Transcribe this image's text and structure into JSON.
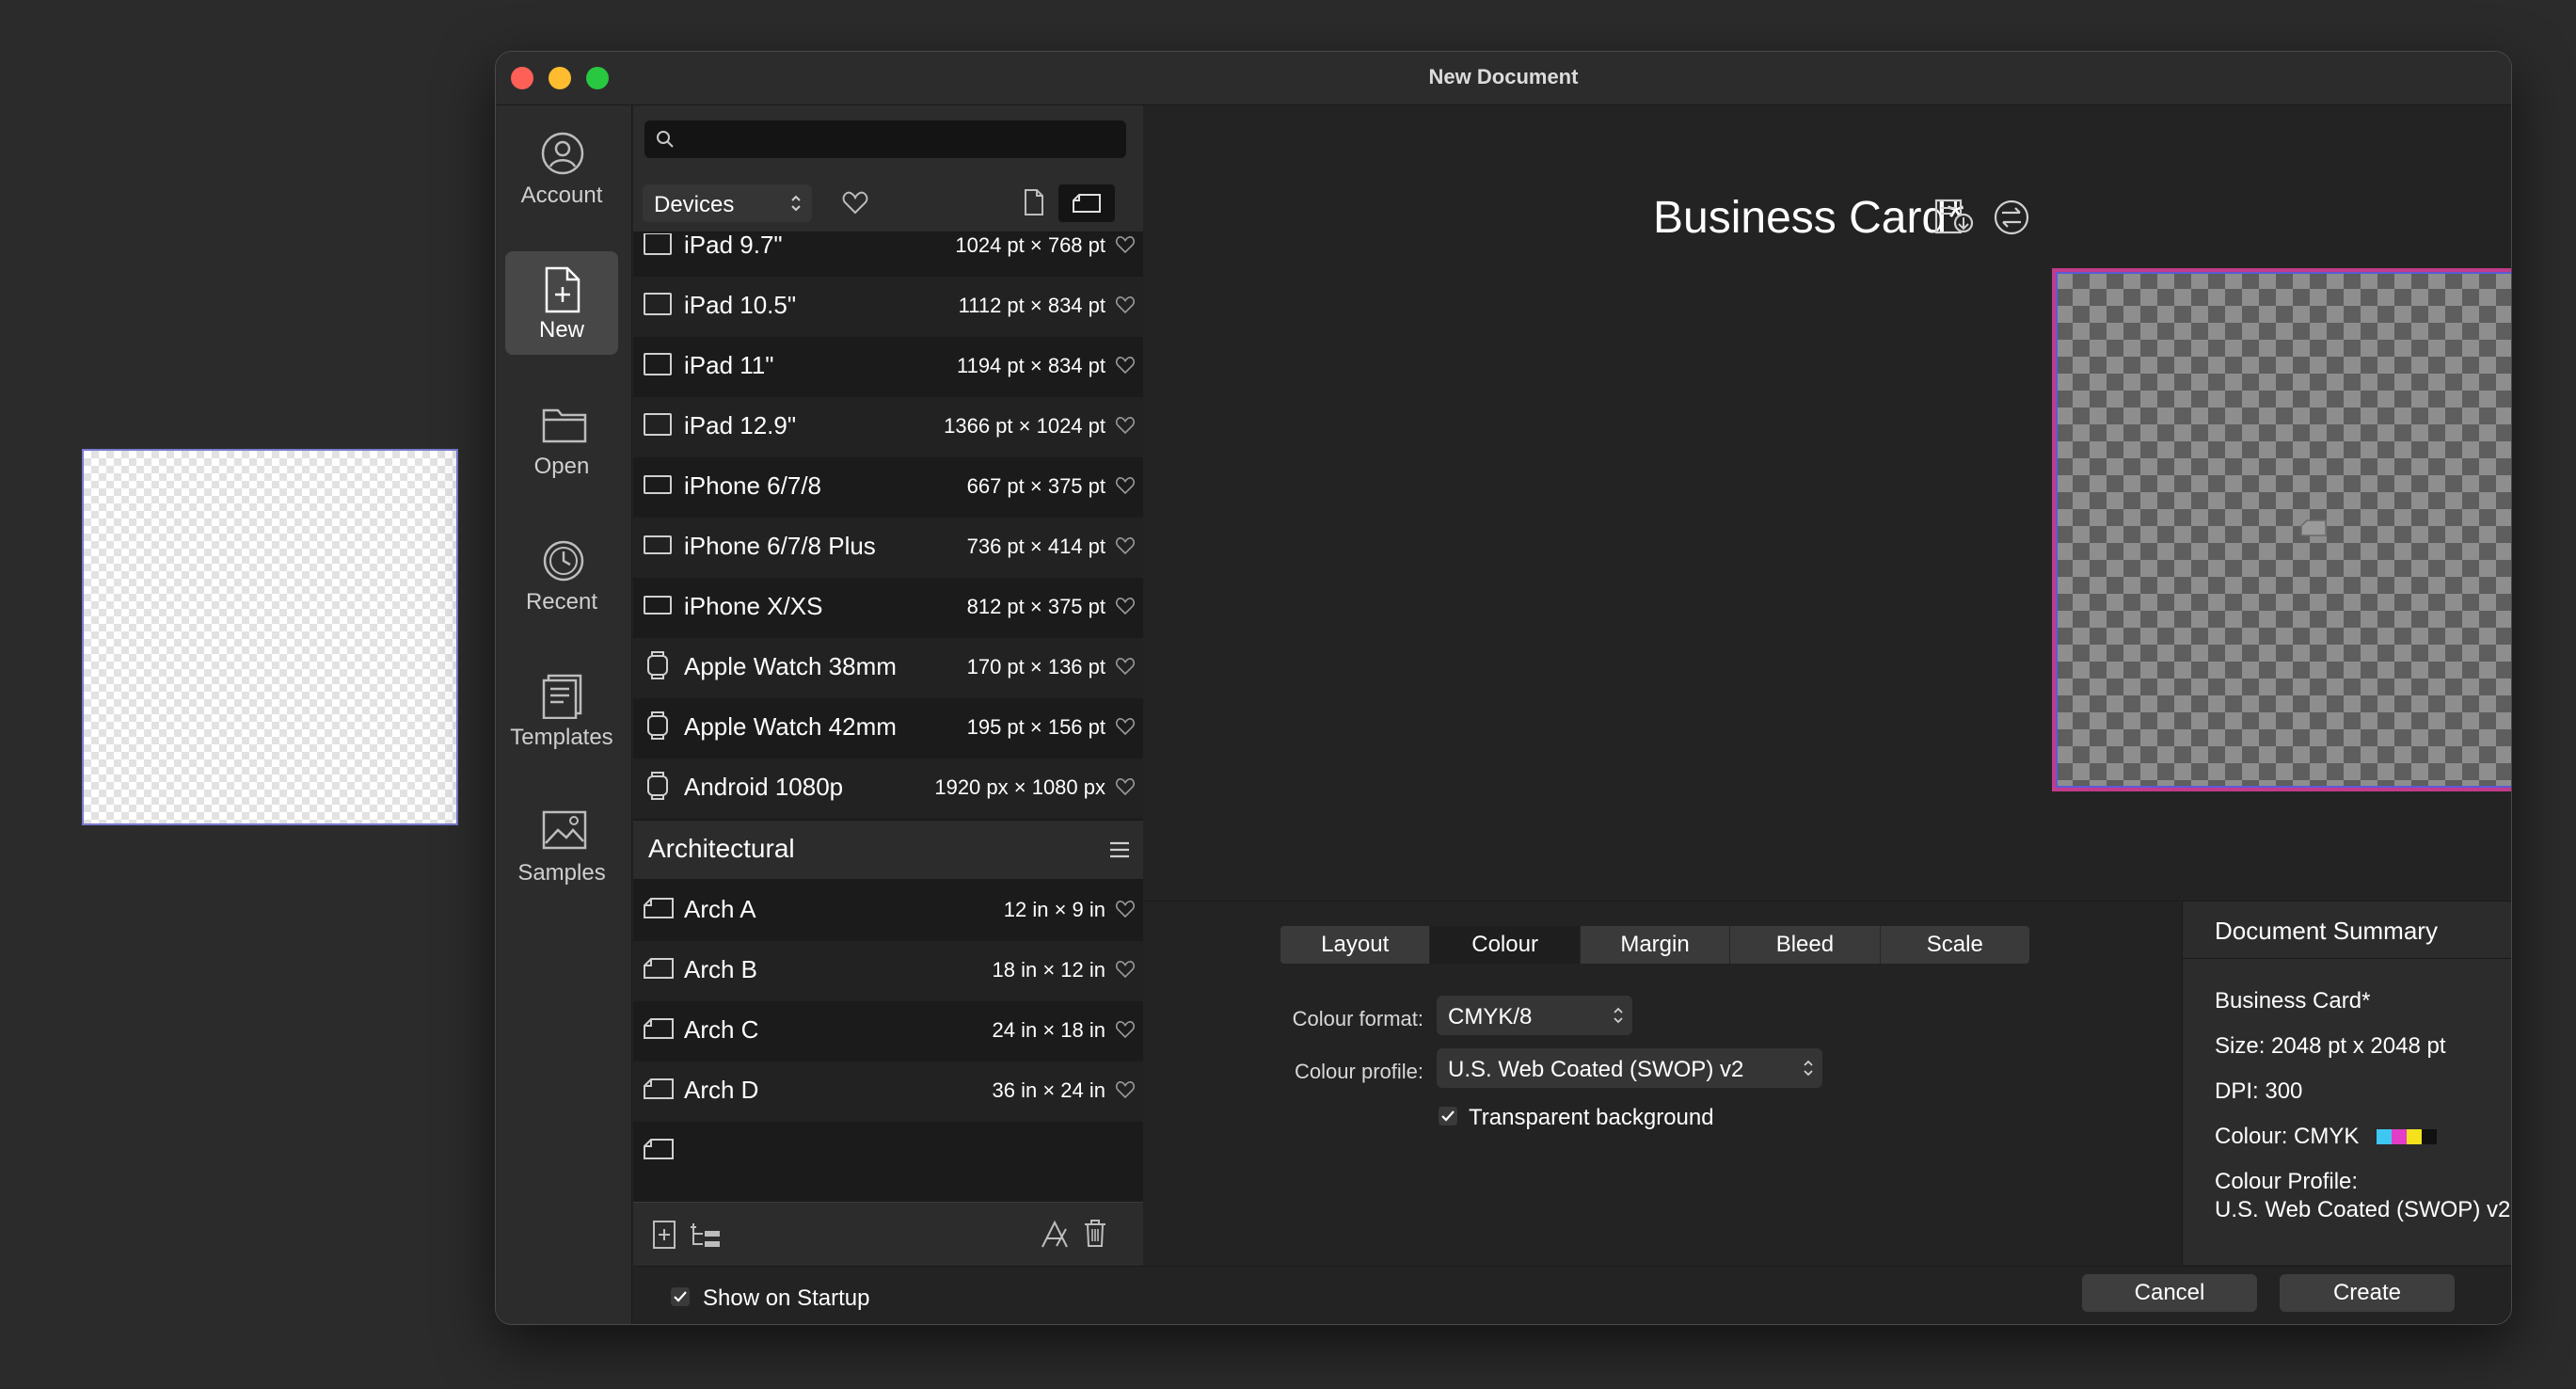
{
  "window": {
    "title": "New Document"
  },
  "sidebar": {
    "items": [
      {
        "label": "Account"
      },
      {
        "label": "New"
      },
      {
        "label": "Open"
      },
      {
        "label": "Recent"
      },
      {
        "label": "Templates"
      },
      {
        "label": "Samples"
      }
    ]
  },
  "presets": {
    "search_placeholder": "",
    "category": "Devices",
    "devices": [
      {
        "name": "iPad 9.7\"",
        "size": "1024 pt × 768 pt"
      },
      {
        "name": "iPad 10.5\"",
        "size": "1112 pt × 834 pt"
      },
      {
        "name": "iPad 11\"",
        "size": "1194 pt × 834 pt"
      },
      {
        "name": "iPad 12.9\"",
        "size": "1366 pt × 1024 pt"
      },
      {
        "name": "iPhone 6/7/8",
        "size": "667 pt × 375 pt"
      },
      {
        "name": "iPhone 6/7/8 Plus",
        "size": "736 pt × 414 pt"
      },
      {
        "name": "iPhone X/XS",
        "size": "812 pt × 375 pt"
      },
      {
        "name": "Apple Watch 38mm",
        "size": "170 pt × 136 pt"
      },
      {
        "name": "Apple Watch 42mm",
        "size": "195 pt × 156 pt"
      },
      {
        "name": "Android 1080p",
        "size": "1920 px × 1080 px"
      }
    ],
    "section_title": "Architectural",
    "architectural": [
      {
        "name": "Arch A",
        "size": "12 in × 9 in"
      },
      {
        "name": "Arch B",
        "size": "18 in × 12 in"
      },
      {
        "name": "Arch C",
        "size": "24 in × 18 in"
      },
      {
        "name": "Arch D",
        "size": "36 in × 24 in"
      }
    ]
  },
  "preview": {
    "doc_title": "Business Card*"
  },
  "settings": {
    "tabs": [
      "Layout",
      "Colour",
      "Margin",
      "Bleed",
      "Scale"
    ],
    "active_tab": "Colour",
    "colour_format_label": "Colour format:",
    "colour_format_value": "CMYK/8",
    "colour_profile_label": "Colour profile:",
    "colour_profile_value": "U.S. Web Coated (SWOP) v2",
    "transparent_label": "Transparent background",
    "transparent_checked": true
  },
  "summary": {
    "heading": "Document Summary",
    "name": "Business Card*",
    "size": "Size: 2048 pt x 2048 pt",
    "dpi": "DPI:  300",
    "colour": "Colour: CMYK",
    "colour_swatches": [
      "#3ec7f0",
      "#e23cc8",
      "#f4e21c",
      "#111111"
    ],
    "profile_label": "Colour Profile:",
    "profile_value": "U.S. Web Coated (SWOP) v2"
  },
  "footer": {
    "show_on_startup": "Show on Startup",
    "show_on_startup_checked": true,
    "cancel": "Cancel",
    "create": "Create"
  },
  "colors": {
    "close": "#fe5f57",
    "minimize": "#febc2e",
    "zoom": "#28c840"
  }
}
